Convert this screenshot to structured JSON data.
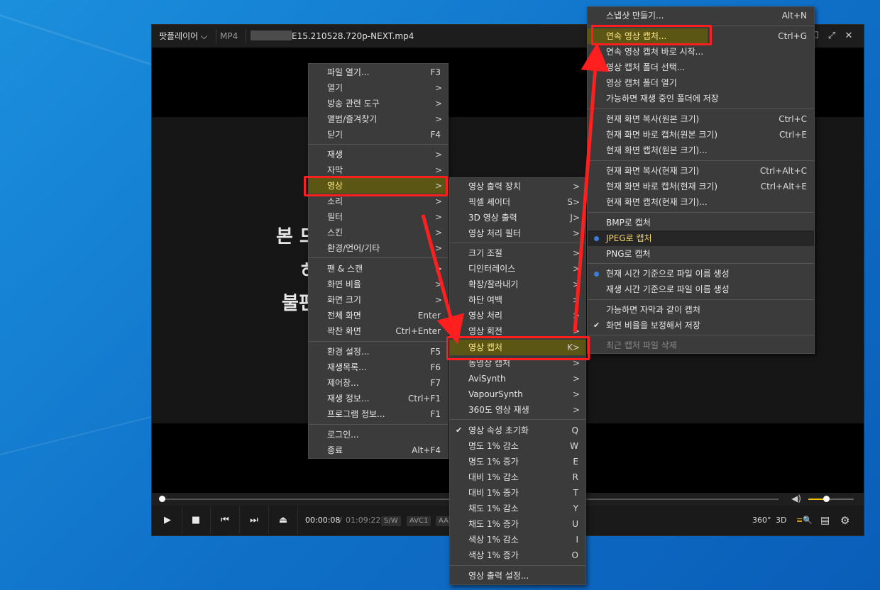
{
  "player": {
    "brand": "팟플레이어 ⌵",
    "format": "MP4",
    "filename": "E15.210528.720p-NEXT.mp4",
    "window_buttons": [
      "☐",
      "⤢",
      "✕"
    ],
    "subtitles": [
      "본 드",
      "하",
      "불편"
    ],
    "time_current": "00:00:08",
    "time_sep": "/",
    "time_total": "01:09:22",
    "badges": [
      "S/W",
      "AVC1",
      "AA"
    ],
    "right_icons": [
      "360°",
      "3D",
      "≡🔍",
      "▤",
      "⚙"
    ],
    "buttons": [
      "▶",
      "■",
      "⏮",
      "⏭",
      "⏏"
    ]
  },
  "main_menu": {
    "items": [
      {
        "label": "파일 열기...",
        "sc": "F3"
      },
      {
        "label": "열기",
        "sub": ">"
      },
      {
        "label": "방송 관련 도구",
        "sub": ">"
      },
      {
        "label": "앨범/즐겨찾기",
        "sub": ">"
      },
      {
        "label": "닫기",
        "sc": "F4"
      },
      {
        "label": "재생",
        "sub": ">"
      },
      {
        "label": "자막",
        "sub": ">"
      },
      {
        "label": "영상",
        "sub": ">"
      },
      {
        "label": "소리",
        "sub": ">"
      },
      {
        "label": "필터",
        "sub": ">"
      },
      {
        "label": "스킨",
        "sub": ">"
      },
      {
        "label": "환경/언어/기타",
        "sub": ">"
      },
      {
        "label": "팬 & 스캔",
        "sub": ">"
      },
      {
        "label": "화면 비율",
        "sub": ">"
      },
      {
        "label": "화면 크기",
        "sub": ">"
      },
      {
        "label": "전체 화면",
        "sc": "Enter"
      },
      {
        "label": "꽉찬 화면",
        "sc": "Ctrl+Enter"
      },
      {
        "label": "환경 설정...",
        "sc": "F5"
      },
      {
        "label": "재생목록...",
        "sc": "F6"
      },
      {
        "label": "제어창...",
        "sc": "F7"
      },
      {
        "label": "재생 정보...",
        "sc": "Ctrl+F1"
      },
      {
        "label": "프로그램 정보...",
        "sc": "F1"
      },
      {
        "label": "로그인..."
      },
      {
        "label": "종료",
        "sc": "Alt+F4"
      }
    ]
  },
  "video_menu": {
    "items": [
      {
        "label": "영상 출력 장치",
        "sub": ">"
      },
      {
        "label": "픽셀 셰이더",
        "sub": "S>"
      },
      {
        "label": "3D 영상 출력",
        "sub": "J>"
      },
      {
        "label": "영상 처리 필터",
        "sub": ">"
      },
      {
        "label": "크기 조절",
        "sub": ">"
      },
      {
        "label": "디인터레이스",
        "sub": ">"
      },
      {
        "label": "확장/잘라내기",
        "sub": ">"
      },
      {
        "label": "하단 여백",
        "sub": ">"
      },
      {
        "label": "영상 처리",
        "sub": ">"
      },
      {
        "label": "영상 회전",
        "sub": ">"
      },
      {
        "label": "영상 캡처",
        "sub": "K>"
      },
      {
        "label": "동영상 캡처",
        "sub": ">"
      },
      {
        "label": "AviSynth",
        "sub": ">"
      },
      {
        "label": "VapourSynth",
        "sub": ">"
      },
      {
        "label": "360도 영상 재생",
        "sub": ">"
      },
      {
        "label": "영상 속성 초기화",
        "sc": "Q"
      },
      {
        "label": "명도 1% 감소",
        "sc": "W"
      },
      {
        "label": "명도 1% 증가",
        "sc": "E"
      },
      {
        "label": "대비 1% 감소",
        "sc": "R"
      },
      {
        "label": "대비 1% 증가",
        "sc": "T"
      },
      {
        "label": "채도 1% 감소",
        "sc": "Y"
      },
      {
        "label": "채도 1% 증가",
        "sc": "U"
      },
      {
        "label": "색상 1% 감소",
        "sc": "I"
      },
      {
        "label": "색상 1% 증가",
        "sc": "O"
      },
      {
        "label": "영상 출력 설정..."
      }
    ]
  },
  "capture_menu": {
    "items": [
      {
        "label": "스냅샷 만들기...",
        "sc": "Alt+N"
      },
      {
        "label": "연속 영상 캡처...",
        "sc": "Ctrl+G"
      },
      {
        "label": "연속 영상 캡처 바로 시작..."
      },
      {
        "label": "영상 캡처 폴더 선택..."
      },
      {
        "label": "영상 캡처 폴더 열기"
      },
      {
        "label": "가능하면 재생 중인 폴더에 저장"
      },
      {
        "label": "현재 화면 복사(원본 크기)",
        "sc": "Ctrl+C"
      },
      {
        "label": "현재 화면 바로 캡처(원본 크기)",
        "sc": "Ctrl+E"
      },
      {
        "label": "현재 화면 캡처(원본 크기)..."
      },
      {
        "label": "현재 화면 복사(현재 크기)",
        "sc": "Ctrl+Alt+C"
      },
      {
        "label": "현재 화면 바로 캡처(현재 크기)",
        "sc": "Ctrl+Alt+E"
      },
      {
        "label": "현재 화면 캡처(현재 크기)..."
      },
      {
        "label": "BMP로 캡처"
      },
      {
        "label": "JPEG로 캡처"
      },
      {
        "label": "PNG로 캡처"
      },
      {
        "label": "현재 시간 기준으로 파일 이름 생성"
      },
      {
        "label": "재생 시간 기준으로 파일 이름 생성"
      },
      {
        "label": "가능하면 자막과 같이 캡처"
      },
      {
        "label": "화면 비율을 보정해서 저장"
      },
      {
        "label": "최근 캡처 파일 삭제"
      }
    ]
  }
}
